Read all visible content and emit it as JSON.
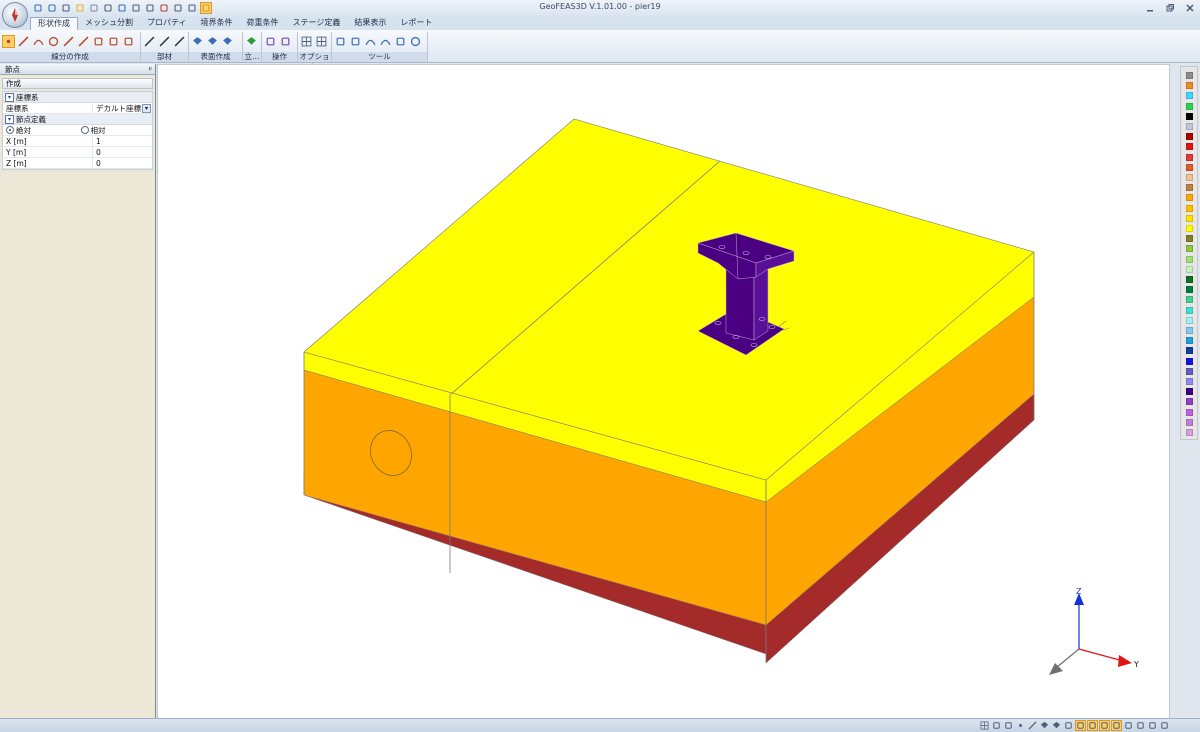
{
  "window": {
    "title": "GeoFEAS3D  V.1.01.00  - pier19"
  },
  "quick_access": [
    {
      "icon": "open-folder-icon",
      "color": "#3a6fb6"
    },
    {
      "icon": "save-icon",
      "color": "#3a6fb6"
    },
    {
      "icon": "print-icon",
      "color": "#4b5f7a"
    },
    {
      "icon": "light-bulb-icon",
      "color": "#e8b21c"
    },
    {
      "icon": "cloud-icon",
      "color": "#7d8ea6"
    },
    {
      "icon": "pointer-icon",
      "color": "#4b5f7a"
    },
    {
      "icon": "rotate-view-icon",
      "color": "#3a6fb6"
    },
    {
      "icon": "camera-icon",
      "color": "#4b5f7a"
    },
    {
      "icon": "zoom-icon",
      "color": "#4b5f7a"
    },
    {
      "icon": "zoom-fit-icon",
      "color": "#c23a3a"
    },
    {
      "icon": "refresh-icon",
      "color": "#4b5f7a"
    },
    {
      "icon": "select-window-icon",
      "color": "#4b5f7a"
    },
    {
      "icon": "select-pointer-icon",
      "color": "#d39a25"
    }
  ],
  "tabs": [
    {
      "label": "形状作成",
      "active": true
    },
    {
      "label": "メッシュ分割",
      "active": false
    },
    {
      "label": "プロパティ",
      "active": false
    },
    {
      "label": "境界条件",
      "active": false
    },
    {
      "label": "荷重条件",
      "active": false
    },
    {
      "label": "ステージ定義",
      "active": false
    },
    {
      "label": "結果表示",
      "active": false
    },
    {
      "label": "レポート",
      "active": false
    }
  ],
  "ribbon_groups": [
    {
      "label": "線分の作成",
      "icons": [
        "node-icon",
        "line-icon",
        "arc-icon",
        "circle-icon",
        "spline-icon",
        "split-line-icon",
        "intersect-icon",
        "divide-icon",
        "extend-icon"
      ]
    },
    {
      "label": "部材",
      "icons": [
        "member-icon",
        "member-delete-icon",
        "member-edit-icon"
      ]
    },
    {
      "label": "表面作成",
      "icons": [
        "surface-icon",
        "surface-extrude-icon",
        "surface-revolve-icon"
      ]
    },
    {
      "label": "立…",
      "icons": [
        "solid-icon"
      ]
    },
    {
      "label": "操作",
      "icons": [
        "transform-icon",
        "copy-icon"
      ]
    },
    {
      "label": "オプション",
      "icons": [
        "grid-snap-icon",
        "grid-icon"
      ]
    },
    {
      "label": "ツール",
      "icons": [
        "measure-icon",
        "erase-icon",
        "undo-icon",
        "redo-icon",
        "pin-icon",
        "help-icon"
      ]
    }
  ],
  "panel": {
    "title": "節点",
    "pin": "ᵖ",
    "section": "作成",
    "coord_category": "座標系",
    "coord_label": "座標系",
    "coord_value": "デカルト座標",
    "node_category": "節点定義",
    "radio_absolute": "絶対",
    "radio_relative": "相対",
    "fields": [
      {
        "label": "X [m]",
        "value": "1"
      },
      {
        "label": "Y [m]",
        "value": "0"
      },
      {
        "label": "Z [m]",
        "value": "0"
      }
    ]
  },
  "axes": {
    "z": "Z",
    "y": "Y"
  },
  "colors": {
    "top_face": "#ffff00",
    "orange_layer": "#ffa500",
    "bottom_layer": "#a52a2a",
    "pier": "#4b0082",
    "axis_z": "#1532d6",
    "axis_y": "#e01414",
    "axis_x": "#707070"
  },
  "palette": [
    "#8c8c8c",
    "#f08a24",
    "#3fd7ff",
    "#2ad14a",
    "#000000",
    "#c0c8d8",
    "#b00000",
    "#e01414",
    "#e03a3a",
    "#e05a2a",
    "#f0c090",
    "#c08040",
    "#ffa500",
    "#ffc000",
    "#ffe000",
    "#ffff00",
    "#808020",
    "#8cc63f",
    "#a0e070",
    "#c8f0c0",
    "#107020",
    "#008040",
    "#40d090",
    "#40e0d0",
    "#a0f0f0",
    "#80c8f0",
    "#20a0e0",
    "#1040a0",
    "#1414e0",
    "#6060c0",
    "#8c8cf0",
    "#400080",
    "#9040c0",
    "#c060e0",
    "#c080d8",
    "#d8a0d8"
  ],
  "status_icons": [
    "view-grid-icon",
    "view-points-icon",
    "view-list-icon",
    "node-toggle-icon",
    "line-toggle-icon",
    "surface-toggle-icon",
    "solid-toggle-icon",
    "mesh-toggle-icon",
    "load-toggle-icon",
    "support-toggle-icon",
    "result-toggle-icon",
    "layer-toggle-icon",
    "scale-toggle-icon",
    "panel-toggle-icon",
    "window-toggle-icon",
    "fullscreen-icon"
  ]
}
